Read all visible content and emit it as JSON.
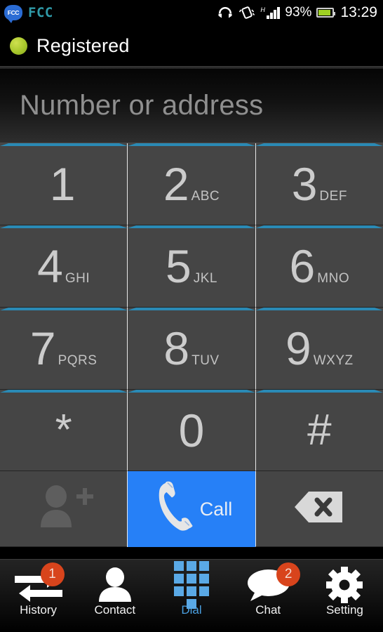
{
  "status_bar": {
    "app_badge_text": "FCC",
    "app_name": "FCC",
    "battery_percent": "93%",
    "time": "13:29",
    "network_type": "H",
    "icons": [
      "headset-icon",
      "vibrate-icon",
      "signal-bars-icon",
      "battery-icon"
    ]
  },
  "header": {
    "status_label": "Registered",
    "status_color": "#a8c72c"
  },
  "input": {
    "placeholder": "Number or address",
    "value": ""
  },
  "keypad": {
    "accent_color": "#2a8ab5",
    "keys": [
      {
        "digit": "1",
        "letters": ""
      },
      {
        "digit": "2",
        "letters": "ABC"
      },
      {
        "digit": "3",
        "letters": "DEF"
      },
      {
        "digit": "4",
        "letters": "GHI"
      },
      {
        "digit": "5",
        "letters": "JKL"
      },
      {
        "digit": "6",
        "letters": "MNO"
      },
      {
        "digit": "7",
        "letters": "PQRS"
      },
      {
        "digit": "8",
        "letters": "TUV"
      },
      {
        "digit": "9",
        "letters": "WXYZ"
      },
      {
        "digit": "*",
        "letters": ""
      },
      {
        "digit": "0",
        "letters": ""
      },
      {
        "digit": "#",
        "letters": ""
      }
    ]
  },
  "actions": {
    "add_contact_icon": "add-contact-icon",
    "call_label": "Call",
    "call_icon": "phone-handset-icon",
    "call_color": "#2680f7",
    "backspace_icon": "backspace-icon"
  },
  "nav": {
    "active": "Dial",
    "active_color": "#4a9fe0",
    "badge_color": "#d8441c",
    "items": [
      {
        "label": "History",
        "icon": "history-arrows-icon",
        "badge": "1"
      },
      {
        "label": "Contact",
        "icon": "person-icon",
        "badge": ""
      },
      {
        "label": "Dial",
        "icon": "dialpad-grid-icon",
        "badge": ""
      },
      {
        "label": "Chat",
        "icon": "speech-bubble-icon",
        "badge": "2"
      },
      {
        "label": "Setting",
        "icon": "gear-icon",
        "badge": ""
      }
    ]
  }
}
